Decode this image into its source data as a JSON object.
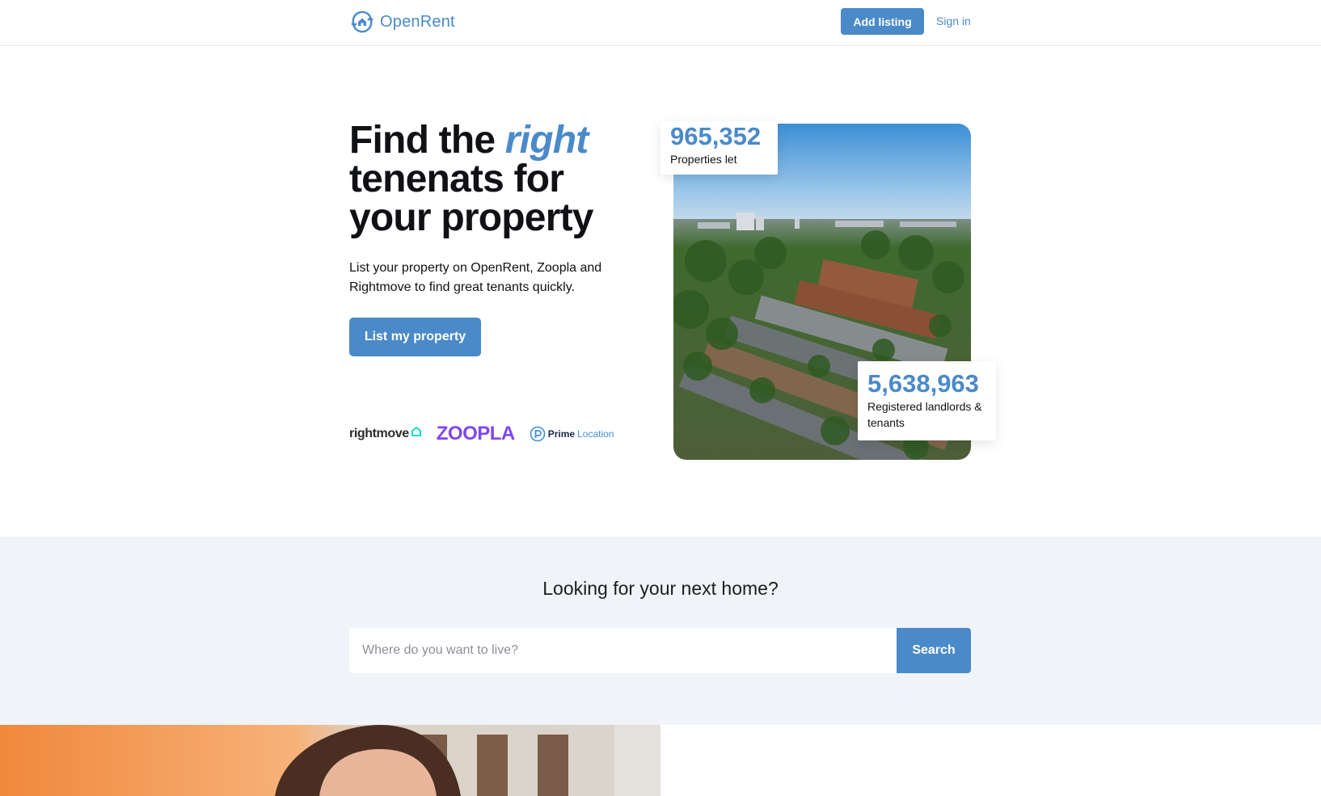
{
  "header": {
    "logo_text": "OpenRent",
    "logo_icon": "house-arrows-icon",
    "add_listing_label": "Add listing",
    "sign_in_label": "Sign in"
  },
  "hero": {
    "title_part1": "Find the ",
    "title_accent": "right",
    "title_part2": "tenenats for your property",
    "subtitle": "List your property on OpenRent, Zoopla and Rightmove to find great tenants quickly.",
    "cta_label": "List my property",
    "partners": {
      "rightmove": "rightmove",
      "zoopla": "ZOOPLA",
      "primelocation_a": "Prime",
      "primelocation_b": "Location"
    },
    "stats": [
      {
        "value": "965,352",
        "label": "Properties let"
      },
      {
        "value": "5,638,963",
        "label": "Registered landlords & tenants"
      }
    ]
  },
  "search": {
    "title": "Looking for your next home?",
    "placeholder": "Where do you want to live?",
    "button_label": "Search"
  },
  "colors": {
    "brand": "#4a8ac9",
    "zoopla": "#8046f1",
    "section_bg": "#f0f3f7"
  }
}
